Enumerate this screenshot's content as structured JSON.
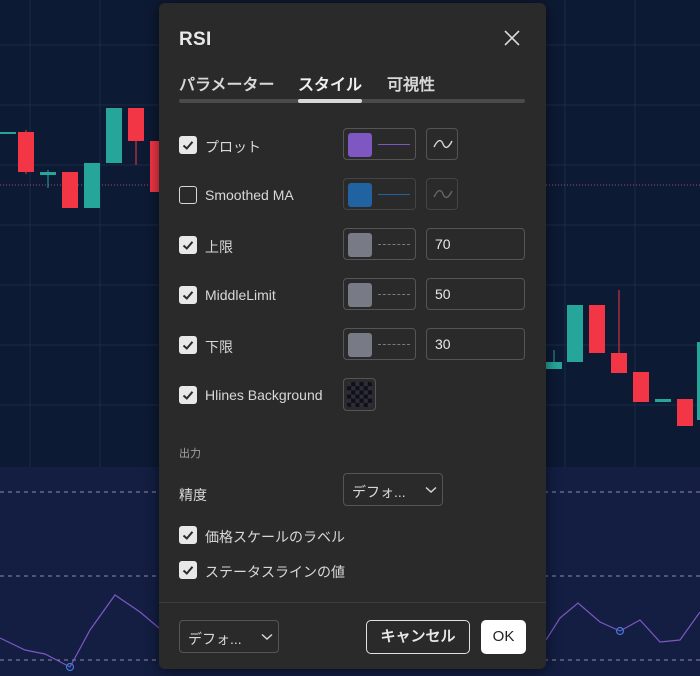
{
  "dialog": {
    "title": "RSI",
    "tabs": [
      {
        "label": "パラメーター"
      },
      {
        "label": "スタイル",
        "active": true
      },
      {
        "label": "可視性"
      }
    ],
    "rows": [
      {
        "label": "プロット",
        "checked": true,
        "swatch_color": "#7e57c2",
        "line_style": "solid",
        "value": null,
        "style_icon": "line-type-icon"
      },
      {
        "label": "Smoothed MA",
        "checked": false,
        "swatch_color": "#2162a0",
        "line_style": "solid",
        "value": null,
        "style_icon": "line-type-icon"
      },
      {
        "label": "上限",
        "checked": true,
        "swatch_color": "#787b86",
        "line_style": "dashed",
        "value": "70"
      },
      {
        "label": "MiddleLimit",
        "checked": true,
        "swatch_color": "#787b86",
        "line_style": "dashed",
        "value": "50"
      },
      {
        "label": "下限",
        "checked": true,
        "swatch_color": "#787b86",
        "line_style": "dashed",
        "value": "30"
      },
      {
        "label": "Hlines Background",
        "checked": true,
        "swatch_color": "#1a1a1a"
      }
    ],
    "output_section": "出力",
    "precision": {
      "label": "精度",
      "value": "デフォ..."
    },
    "toggles": [
      {
        "label": "価格スケールのラベル",
        "checked": true
      },
      {
        "label": "ステータスラインの値",
        "checked": true
      }
    ],
    "footer": {
      "defaults_value": "デフォ...",
      "cancel_label": "キャンセル",
      "ok_label": "OK"
    }
  },
  "colors": {
    "chart_bg": "#0d1a33",
    "dialog_bg": "#2a2a2a",
    "candle_up": "#26a69a",
    "candle_down": "#f23645",
    "rsi_line": "#7e57c2"
  }
}
